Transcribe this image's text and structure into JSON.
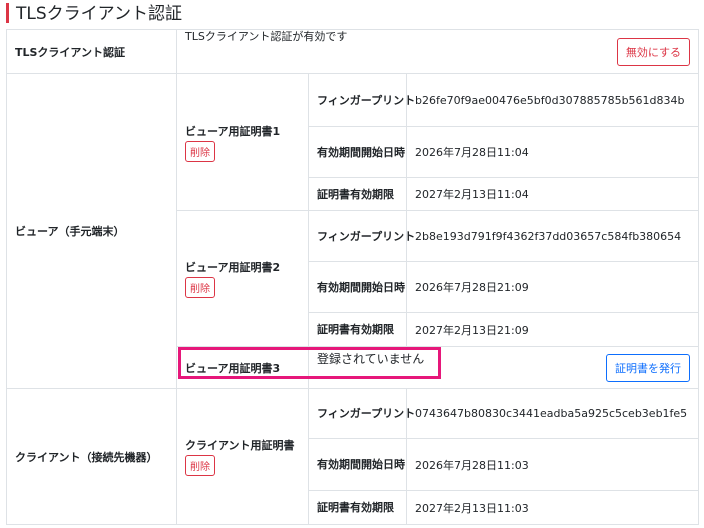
{
  "header": {
    "title": "TLSクライアント認証"
  },
  "tls": {
    "label": "TLSクライアント認証",
    "status": "TLSクライアント認証が有効です",
    "disable_button": "無効にする"
  },
  "fields": {
    "fingerprint": "フィンガープリント",
    "valid_from": "有効期間開始日時",
    "valid_to": "証明書有効期限"
  },
  "viewer": {
    "label": "ビューア（手元端末）",
    "certs": [
      {
        "name": "ビューア用証明書1",
        "delete_label": "削除",
        "fingerprint": "b26fe70f9ae00476e5bf0d307885785b561d834b",
        "valid_from": "2026年7月28日11:04",
        "valid_to": "2027年2月13日11:04"
      },
      {
        "name": "ビューア用証明書2",
        "delete_label": "削除",
        "fingerprint": "2b8e193d791f9f4362f37dd03657c584fb380654",
        "valid_from": "2026年7月28日21:09",
        "valid_to": "2027年2月13日21:09"
      }
    ],
    "cert3": {
      "name": "ビューア用証明書3",
      "status": "登録されていません",
      "issue_button": "証明書を発行"
    }
  },
  "client": {
    "label": "クライアント（接続先機器）",
    "cert": {
      "name": "クライアント用証明書",
      "delete_label": "削除",
      "fingerprint": "0743647b80830c3441eadba5a925c5ceb3eb1fe5",
      "valid_from": "2026年7月28日11:03",
      "valid_to": "2027年2月13日11:03"
    }
  },
  "colors": {
    "accent": "#dc3545",
    "primary": "#0d6efd",
    "highlight": "#e6177a",
    "border": "#dee2e6"
  }
}
